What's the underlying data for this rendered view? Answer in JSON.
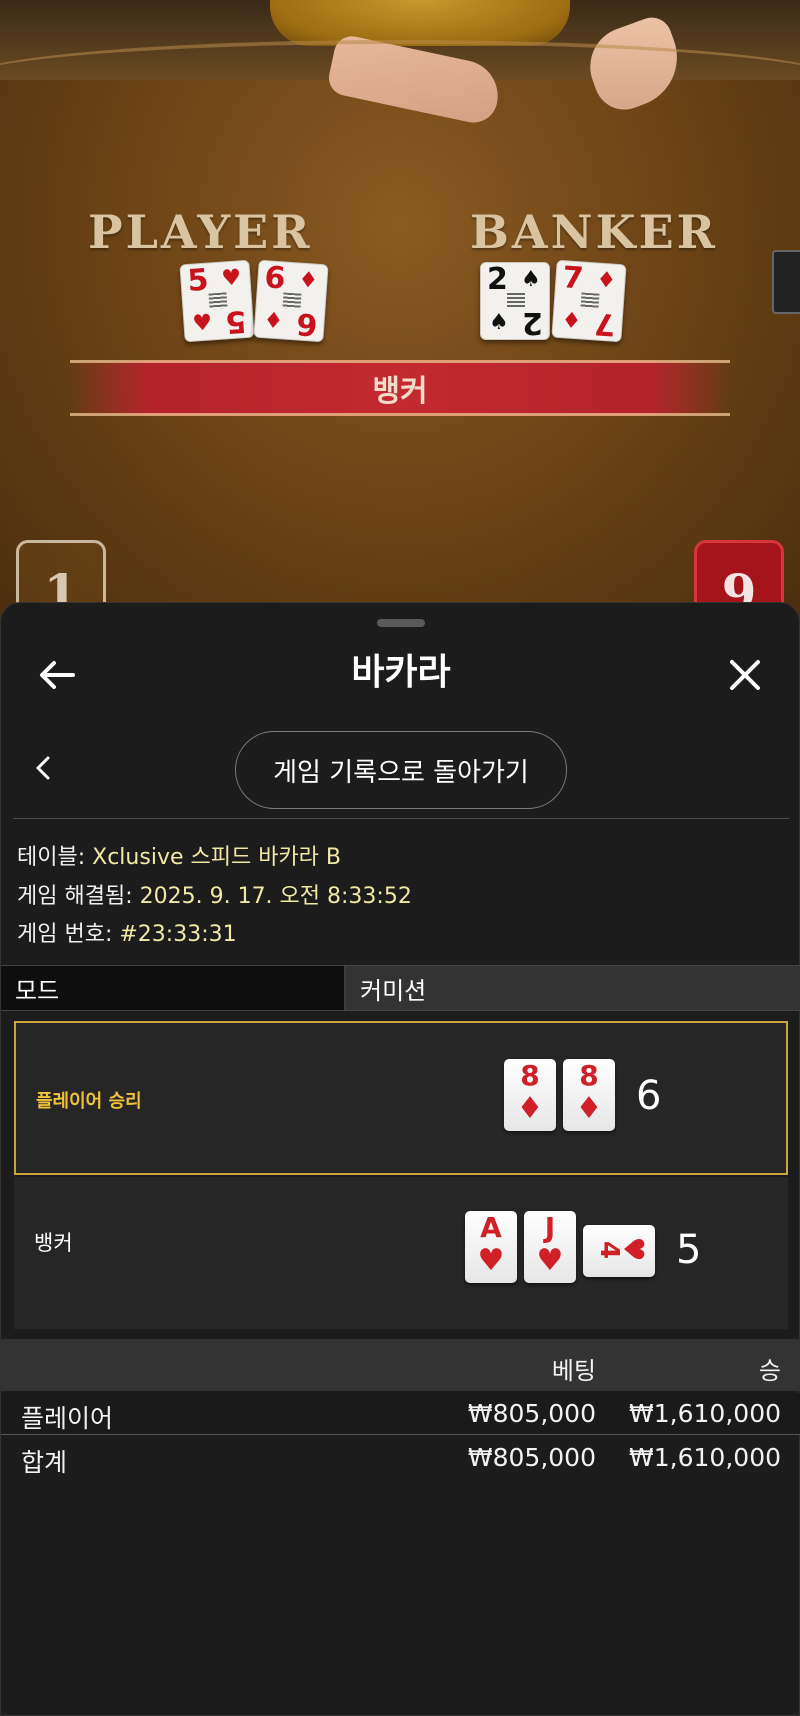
{
  "table": {
    "player_label": "PLAYER",
    "banker_label": "BANKER",
    "player_cards": [
      {
        "rank": "5",
        "suit": "♥",
        "color": "red"
      },
      {
        "rank": "6",
        "suit": "♦",
        "color": "red"
      }
    ],
    "banker_cards": [
      {
        "rank": "2",
        "suit": "♠",
        "color": "black"
      },
      {
        "rank": "7",
        "suit": "♦",
        "color": "red"
      }
    ],
    "result_banner": "뱅커",
    "player_score": "1",
    "banker_score": "9"
  },
  "sheet": {
    "title": "바카라",
    "back_icon": "arrow-left-icon",
    "close_icon": "close-icon",
    "return_button": "게임 기록으로 돌아가기",
    "info": {
      "table_label": "테이블: ",
      "table_value": "Xclusive 스피드 바카라 B",
      "resolved_label": "게임 해결됨: ",
      "resolved_value": "2025. 9. 17. 오전 8:33:52",
      "number_label": "게임 번호: ",
      "number_value": "#23:33:31"
    },
    "tabs": {
      "mode": "모드",
      "commission": "커미션"
    },
    "results": {
      "player": {
        "label": "플레이어 승리",
        "cards": [
          {
            "rank": "8",
            "suit": "♦"
          },
          {
            "rank": "8",
            "suit": "♦"
          }
        ],
        "total": "6"
      },
      "banker": {
        "label": "뱅커",
        "cards": [
          {
            "rank": "A",
            "suit": "♥"
          },
          {
            "rank": "J",
            "suit": "♥"
          },
          {
            "rank": "4",
            "suit": "♥",
            "sideways": true
          }
        ],
        "total": "5"
      }
    },
    "bets": {
      "headers": {
        "name": "",
        "bet": "베팅",
        "win": "승"
      },
      "rows": [
        {
          "name": "플레이어",
          "bet": "₩805,000",
          "win": "₩1,610,000"
        },
        {
          "name": "합계",
          "bet": "₩805,000",
          "win": "₩1,610,000"
        }
      ]
    },
    "colors": {
      "accent": "#c9a53a",
      "win_label": "#f0c23a",
      "info_value": "#f1e8a6",
      "card_red": "#d11f28"
    }
  }
}
